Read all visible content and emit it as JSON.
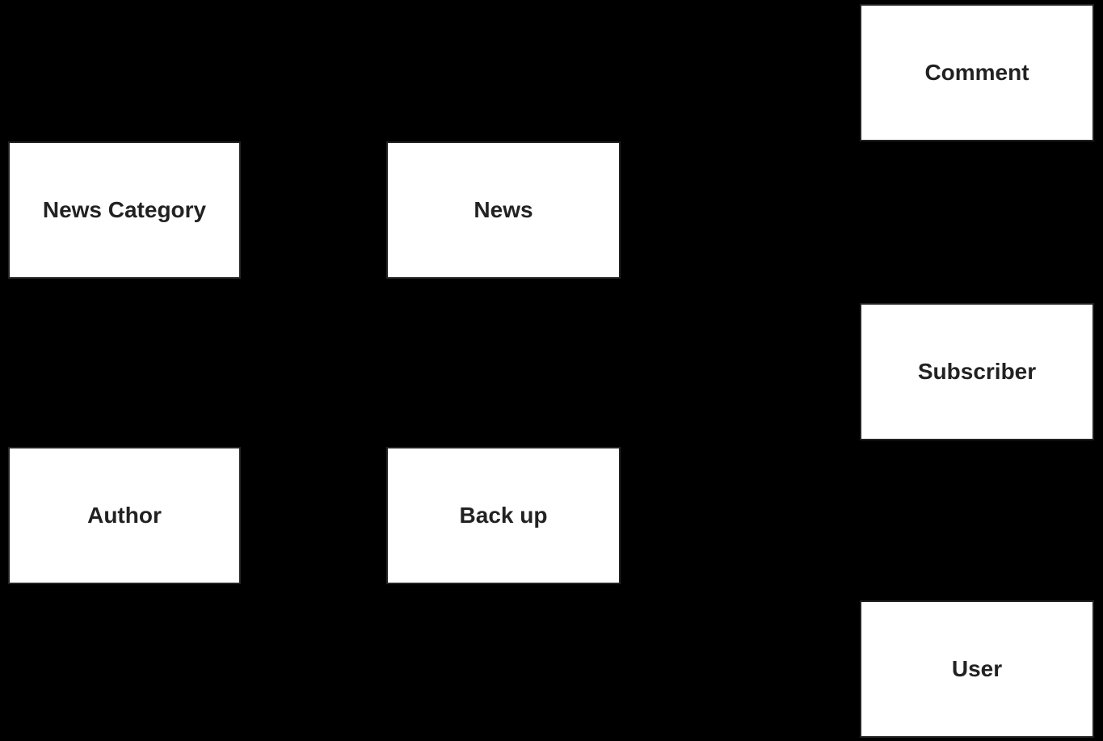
{
  "boxes": {
    "news_category": "News Category",
    "news": "News",
    "author": "Author",
    "backup": "Back up",
    "comment": "Comment",
    "subscriber": "Subscriber",
    "user": "User"
  }
}
